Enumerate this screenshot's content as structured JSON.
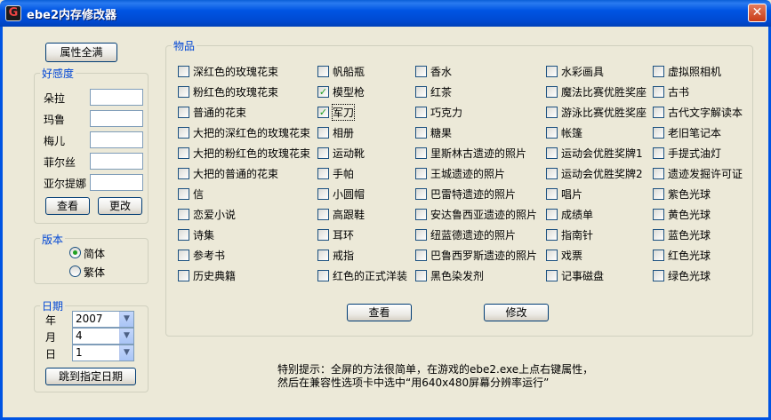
{
  "window": {
    "title": "ebe2内存修改器",
    "close": "✕",
    "icon_glyph": "G"
  },
  "left": {
    "max_attr_button": "属性全满",
    "affection": {
      "legend": "好感度",
      "rows": [
        "朵拉",
        "玛鲁",
        "梅儿",
        "菲尔丝",
        "亚尔提娜"
      ],
      "view_button": "查看",
      "modify_button": "更改"
    },
    "version": {
      "legend": "版本",
      "options": [
        {
          "label": "简体",
          "selected": true
        },
        {
          "label": "繁体",
          "selected": false
        }
      ]
    },
    "date": {
      "legend": "日期",
      "fields": [
        {
          "label": "年",
          "value": "2007"
        },
        {
          "label": "月",
          "value": "4"
        },
        {
          "label": "日",
          "value": "1"
        }
      ],
      "jump_button": "跳到指定日期"
    }
  },
  "items": {
    "legend": "物品",
    "columns": [
      [
        {
          "label": "深红色的玫瑰花束",
          "checked": false
        },
        {
          "label": "粉红色的玫瑰花束",
          "checked": false
        },
        {
          "label": "普通的花束",
          "checked": false
        },
        {
          "label": "大把的深红色的玫瑰花束",
          "checked": false
        },
        {
          "label": "大把的粉红色的玫瑰花束",
          "checked": false
        },
        {
          "label": "大把的普通的花束",
          "checked": false
        },
        {
          "label": "信",
          "checked": false
        },
        {
          "label": "恋爱小说",
          "checked": false
        },
        {
          "label": "诗集",
          "checked": false
        },
        {
          "label": "参考书",
          "checked": false
        },
        {
          "label": "历史典籍",
          "checked": false
        }
      ],
      [
        {
          "label": "帆船瓶",
          "checked": false
        },
        {
          "label": "模型枪",
          "checked": true
        },
        {
          "label": "军刀",
          "checked": true,
          "focused": true
        },
        {
          "label": "相册",
          "checked": false
        },
        {
          "label": "运动靴",
          "checked": false
        },
        {
          "label": "手帕",
          "checked": false
        },
        {
          "label": "小圆帽",
          "checked": false
        },
        {
          "label": "高跟鞋",
          "checked": false
        },
        {
          "label": "耳环",
          "checked": false
        },
        {
          "label": "戒指",
          "checked": false
        },
        {
          "label": "红色的正式洋装",
          "checked": false
        }
      ],
      [
        {
          "label": "香水",
          "checked": false
        },
        {
          "label": "红茶",
          "checked": false
        },
        {
          "label": "巧克力",
          "checked": false
        },
        {
          "label": "糖果",
          "checked": false
        },
        {
          "label": "里斯林古遗迹的照片",
          "checked": false
        },
        {
          "label": "王城遗迹的照片",
          "checked": false
        },
        {
          "label": "巴雷特遗迹的照片",
          "checked": false
        },
        {
          "label": "安达鲁西亚遗迹的照片",
          "checked": false
        },
        {
          "label": "纽蓝德遗迹的照片",
          "checked": false
        },
        {
          "label": "巴鲁西罗斯遗迹的照片",
          "checked": false
        },
        {
          "label": "黑色染发剂",
          "checked": false
        }
      ],
      [
        {
          "label": "水彩画具",
          "checked": false
        },
        {
          "label": "魔法比赛优胜奖座",
          "checked": false
        },
        {
          "label": "游泳比赛优胜奖座",
          "checked": false
        },
        {
          "label": "帐篷",
          "checked": false
        },
        {
          "label": "运动会优胜奖牌1",
          "checked": false
        },
        {
          "label": "运动会优胜奖牌2",
          "checked": false
        },
        {
          "label": "唱片",
          "checked": false
        },
        {
          "label": "成绩单",
          "checked": false
        },
        {
          "label": "指南针",
          "checked": false
        },
        {
          "label": "戏票",
          "checked": false
        },
        {
          "label": "记事磁盘",
          "checked": false
        }
      ],
      [
        {
          "label": "虚拟照相机",
          "checked": false
        },
        {
          "label": "古书",
          "checked": false
        },
        {
          "label": "古代文字解读本",
          "checked": false
        },
        {
          "label": "老旧笔记本",
          "checked": false
        },
        {
          "label": "手提式油灯",
          "checked": false
        },
        {
          "label": "遗迹发掘许可证",
          "checked": false
        },
        {
          "label": "紫色光球",
          "checked": false
        },
        {
          "label": "黄色光球",
          "checked": false
        },
        {
          "label": "蓝色光球",
          "checked": false
        },
        {
          "label": "红色光球",
          "checked": false
        },
        {
          "label": "绿色光球",
          "checked": false
        }
      ]
    ],
    "view_button": "查看",
    "modify_button": "修改"
  },
  "tip": {
    "line1": "特别提示：全屏的方法很简单，在游戏的ebe2.exe上点右键属性，",
    "line2": "然后在兼容性选项卡中选中“用640x480屏幕分辨率运行”"
  }
}
